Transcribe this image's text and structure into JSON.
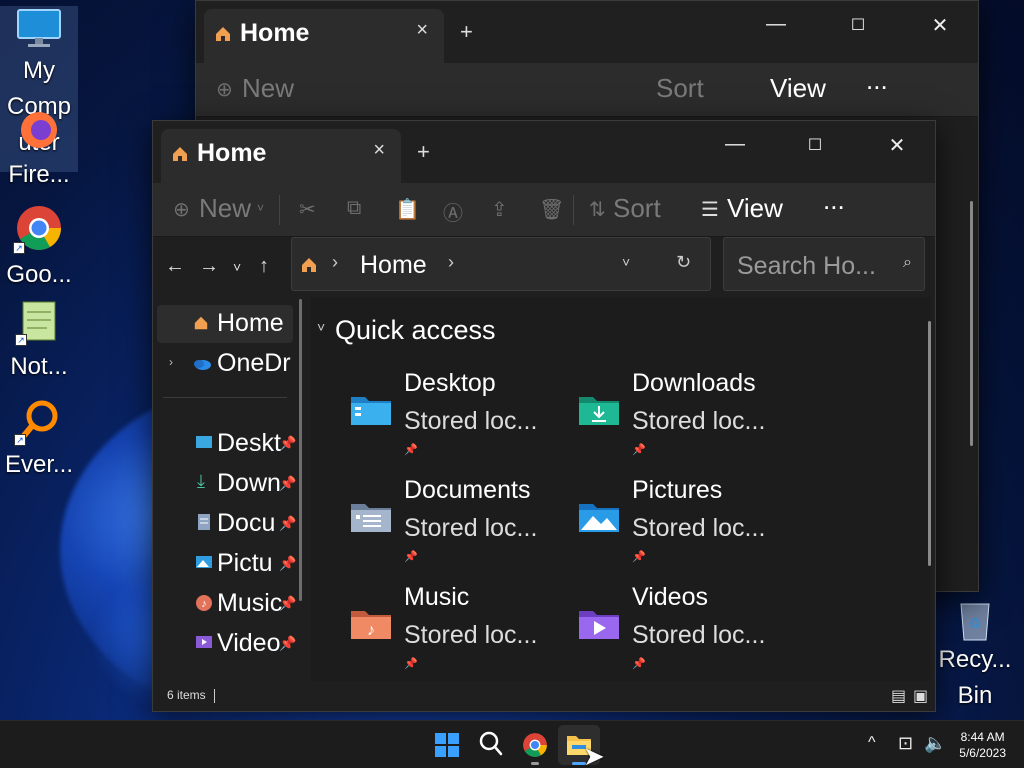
{
  "desktop": {
    "icons": [
      {
        "label": "My",
        "label2": "Comp",
        "label3": "uter"
      },
      {
        "label": "Fire..."
      },
      {
        "label": "Goo..."
      },
      {
        "label": "Not..."
      },
      {
        "label": "Ever..."
      }
    ],
    "recycle_bin": {
      "label": "Recy...",
      "label2": "Bin"
    }
  },
  "back_window": {
    "tab_title": "Home",
    "toolbar": {
      "new": "New",
      "sort": "Sort",
      "view": "View",
      "more": "..."
    }
  },
  "front_window": {
    "tab_title": "Home",
    "tab_close": "×",
    "new_tab": "+",
    "controls": {
      "minimize": "—",
      "maximize": "☐",
      "close": "✕"
    },
    "toolbar": {
      "new": "New",
      "sort": "Sort",
      "view": "View",
      "more": "..."
    },
    "address": {
      "crumb": "Home",
      "sep": "›"
    },
    "search": {
      "placeholder": "Search Ho..."
    },
    "nav": [
      {
        "label": "Home",
        "icon": "home-icon",
        "selected": true
      },
      {
        "label": "OneDr",
        "icon": "onedrive-icon"
      },
      {
        "label": "Deskt",
        "icon": "desktop-folder-icon",
        "pinned": true
      },
      {
        "label": "Down",
        "icon": "download-icon",
        "pinned": true
      },
      {
        "label": "Docu",
        "icon": "documents-icon",
        "pinned": true
      },
      {
        "label": "Pictu",
        "icon": "pictures-icon",
        "pinned": true
      },
      {
        "label": "Music",
        "icon": "music-icon",
        "pinned": true
      },
      {
        "label": "Video",
        "icon": "videos-icon",
        "pinned": true
      }
    ],
    "quick_access": {
      "title": "Quick access",
      "items": [
        {
          "name": "Desktop",
          "sub": "Stored loc...",
          "icon": "desktop-folder-icon"
        },
        {
          "name": "Downloads",
          "sub": "Stored loc...",
          "icon": "downloads-folder-icon"
        },
        {
          "name": "Documents",
          "sub": "Stored loc...",
          "icon": "documents-folder-icon"
        },
        {
          "name": "Pictures",
          "sub": "Stored loc...",
          "icon": "pictures-folder-icon"
        },
        {
          "name": "Music",
          "sub": "Stored loc...",
          "icon": "music-folder-icon"
        },
        {
          "name": "Videos",
          "sub": "Stored loc...",
          "icon": "videos-folder-icon"
        }
      ]
    },
    "status": {
      "count": "6 items"
    }
  },
  "taskbar": {
    "time": "8:44 AM",
    "date": "5/6/2023",
    "apps": [
      "start-icon",
      "search-icon",
      "chrome-icon",
      "file-explorer-icon"
    ]
  }
}
